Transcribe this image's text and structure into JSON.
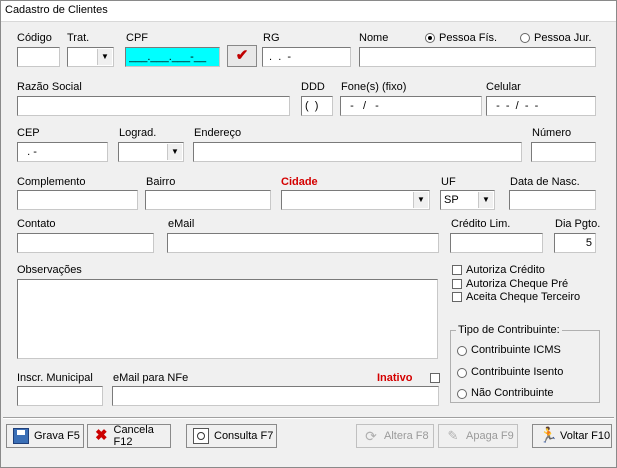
{
  "window": {
    "title": "Cadastro de Clientes"
  },
  "labels": {
    "codigo": "Código",
    "trat": "Trat.",
    "cpf": "CPF",
    "rg": "RG",
    "nome": "Nome",
    "razao_social": "Razão Social",
    "ddd": "DDD",
    "fone": "Fone(s) (fixo)",
    "celular": "Celular",
    "cep": "CEP",
    "lograd": "Lograd.",
    "endereco": "Endereço",
    "numero": "Número",
    "complemento": "Complemento",
    "bairro": "Bairro",
    "cidade": "Cidade",
    "uf": "UF",
    "data_nasc": "Data de Nasc.",
    "contato": "Contato",
    "email": "eMail",
    "credito_lim": "Crédito Lim.",
    "dia_pgto": "Dia Pgto.",
    "observacoes": "Observações",
    "inscr_municipal": "Inscr. Municipal",
    "email_nfe": "eMail para NFe",
    "inativo": "Inativo"
  },
  "person_type": {
    "fisica": "Pessoa Fís.",
    "juridica": "Pessoa Jur.",
    "selected": "fisica"
  },
  "values": {
    "codigo": "",
    "cpf": "___.___.___-__",
    "rg": " .  .  -",
    "nome": "",
    "razao_social": "",
    "ddd": "(  )",
    "fone": "  -   /   -",
    "celular": "  -  -  /  -  -",
    "cep": "  . -",
    "endereco": "",
    "numero": "",
    "complemento": "",
    "bairro": "",
    "contato": "",
    "email": "",
    "credito_lim": "",
    "dia_pgto": "5",
    "observacoes": "",
    "inscr_municipal": "",
    "email_nfe": "",
    "uf": "SP",
    "trat": "",
    "lograd": "",
    "cidade": ""
  },
  "checks": {
    "autoriza_credito": "Autoriza Crédito",
    "autoriza_cheque_pre": "Autoriza Cheque Pré",
    "aceita_cheque_terceiro": "Aceita Cheque Terceiro"
  },
  "tipo_contribuinte": {
    "title": "Tipo de Contribuinte:",
    "options": [
      "Contribuinte ICMS",
      "Contribuinte Isento",
      "Não Contribuinte"
    ]
  },
  "toolbar": {
    "grava": "Grava F5",
    "cancela": "Cancela F12",
    "consulta": "Consulta F7",
    "altera": "Altera F8",
    "apaga": "Apaga F9",
    "voltar": "Voltar F10"
  },
  "colors": {
    "required": "#d40000",
    "cpf_focus": "#00ffff"
  }
}
